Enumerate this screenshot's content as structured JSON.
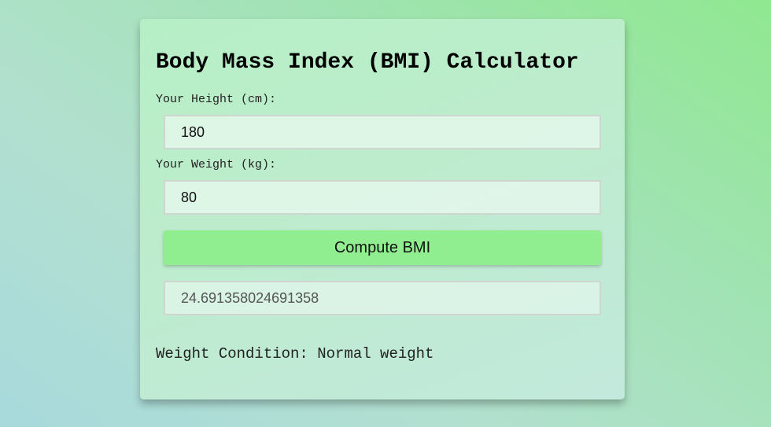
{
  "calculator": {
    "title": "Body Mass Index (BMI) Calculator",
    "height_label": "Your Height (cm):",
    "height_value": "180",
    "weight_label": "Your Weight (kg):",
    "weight_value": "80",
    "compute_button_label": "Compute BMI",
    "bmi_result": "24.691358024691358",
    "condition_text": "Weight Condition: Normal weight"
  },
  "colors": {
    "button": "#90ee90",
    "background_start": "#a8dadc",
    "background_end": "#90e890"
  }
}
